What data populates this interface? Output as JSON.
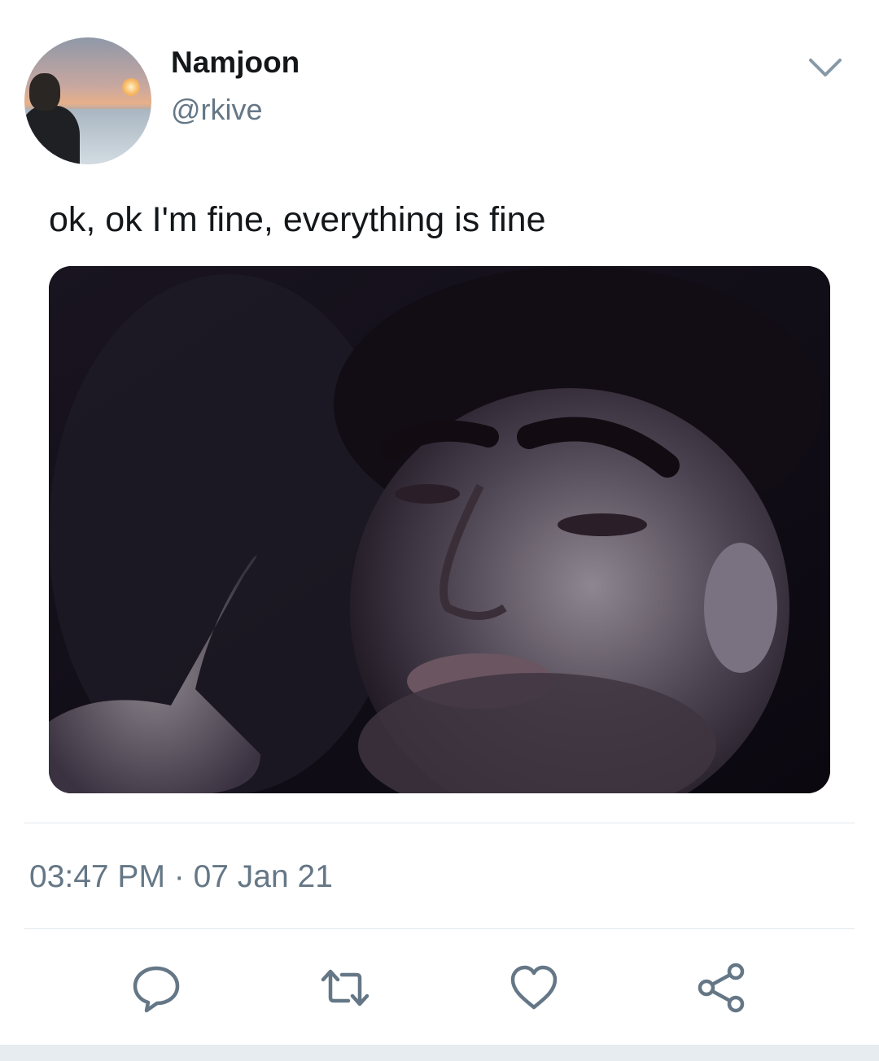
{
  "tweet": {
    "author": {
      "display_name": "Namjoon",
      "handle": "@rkive",
      "avatar_icon": "profile-photo"
    },
    "text": "ok, ok I'm fine, everything is fine",
    "media": {
      "type": "photo"
    },
    "timestamp": "03:47 PM · 07 Jan 21"
  },
  "header": {
    "menu_icon": "chevron-down-icon"
  },
  "actions": [
    {
      "icon": "reply-icon"
    },
    {
      "icon": "retweet-icon"
    },
    {
      "icon": "like-icon"
    },
    {
      "icon": "share-icon"
    }
  ],
  "colors": {
    "primary_text": "#14171a",
    "secondary_text": "#657786",
    "icon": "#657786",
    "divider": "#e1e8ed",
    "background": "#ffffff"
  }
}
